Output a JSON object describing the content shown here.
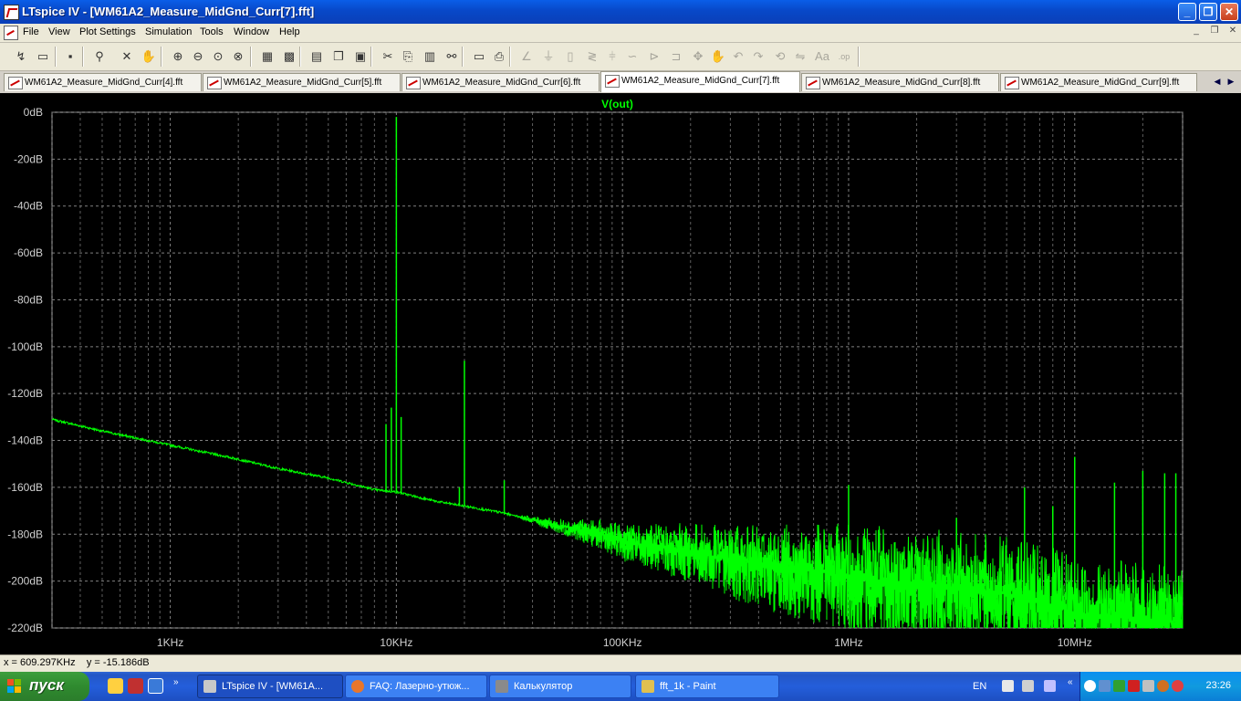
{
  "window": {
    "title": "LTspice IV - [WM61A2_Measure_MidGnd_Curr[7].fft]",
    "controls": {
      "minimize": "_",
      "restore": "❐",
      "close": "✕"
    }
  },
  "menubar": {
    "items": [
      "File",
      "View",
      "Plot Settings",
      "Simulation",
      "Tools",
      "Window",
      "Help"
    ],
    "mdi": {
      "minimize": "_",
      "restore": "❐",
      "close": "✕"
    }
  },
  "toolbar": {
    "buttons": [
      {
        "icon": "run-icon",
        "glyph": "↯"
      },
      {
        "icon": "open-icon",
        "glyph": "▭"
      },
      {
        "icon": "save-icon",
        "glyph": "▪"
      },
      {
        "icon": "probe-icon",
        "glyph": "⚲"
      },
      {
        "icon": "halt-icon",
        "glyph": "✕"
      },
      {
        "icon": "pan-icon",
        "glyph": "✋"
      },
      {
        "icon": "zoom-in-icon",
        "glyph": "⊕"
      },
      {
        "icon": "zoom-out-icon",
        "glyph": "⊖"
      },
      {
        "icon": "zoom-fit-icon",
        "glyph": "⊙"
      },
      {
        "icon": "zoom-cancel-icon",
        "glyph": "⊗"
      },
      {
        "icon": "autorange-icon",
        "glyph": "▦"
      },
      {
        "icon": "grid-icon",
        "glyph": "▩"
      },
      {
        "icon": "tile-horizontal-icon",
        "glyph": "▤"
      },
      {
        "icon": "cascade-icon",
        "glyph": "❐"
      },
      {
        "icon": "close-window-icon",
        "glyph": "▣"
      },
      {
        "icon": "cut-icon",
        "glyph": "✂"
      },
      {
        "icon": "copy-icon",
        "glyph": "⎘"
      },
      {
        "icon": "paste-icon",
        "glyph": "▥"
      },
      {
        "icon": "find-icon",
        "glyph": "⚯"
      },
      {
        "icon": "print-setup-icon",
        "glyph": "▭"
      },
      {
        "icon": "print-icon",
        "glyph": "⎙"
      },
      {
        "icon": "wire-icon",
        "glyph": "∠"
      },
      {
        "icon": "ground-icon",
        "glyph": "⏚"
      },
      {
        "icon": "label-icon",
        "glyph": "▯"
      },
      {
        "icon": "resistor-icon",
        "glyph": "≷"
      },
      {
        "icon": "capacitor-icon",
        "glyph": "⫩"
      },
      {
        "icon": "inductor-icon",
        "glyph": "∽"
      },
      {
        "icon": "diode-icon",
        "glyph": "⊳"
      },
      {
        "icon": "component-icon",
        "glyph": "⊐"
      },
      {
        "icon": "move-icon",
        "glyph": "✥"
      },
      {
        "icon": "drag-icon",
        "glyph": "✋"
      },
      {
        "icon": "undo-icon",
        "glyph": "↶"
      },
      {
        "icon": "redo-icon",
        "glyph": "↷"
      },
      {
        "icon": "rotate-icon",
        "glyph": "⟲"
      },
      {
        "icon": "mirror-icon",
        "glyph": "⇋"
      },
      {
        "icon": "text-icon",
        "glyph": "Aa"
      },
      {
        "icon": "spice-directive-icon",
        "glyph": ".op"
      }
    ]
  },
  "tabs": [
    {
      "label": "WM61A2_Measure_MidGnd_Curr[4].fft",
      "active": false
    },
    {
      "label": "WM61A2_Measure_MidGnd_Curr[5].fft",
      "active": false
    },
    {
      "label": "WM61A2_Measure_MidGnd_Curr[6].fft",
      "active": false
    },
    {
      "label": "WM61A2_Measure_MidGnd_Curr[7].fft",
      "active": true
    },
    {
      "label": "WM61A2_Measure_MidGnd_Curr[8].fft",
      "active": false
    },
    {
      "label": "WM61A2_Measure_MidGnd_Curr[9].fft",
      "active": false
    }
  ],
  "tab_nav": {
    "prev": "◀",
    "next": "▶"
  },
  "chart_data": {
    "type": "line",
    "trace_label": "V(out)",
    "x_scale": "log",
    "xlim": [
      300,
      30000000
    ],
    "ylim": [
      -220,
      0
    ],
    "x_ticks": [
      {
        "value": 1000,
        "label": "1KHz"
      },
      {
        "value": 10000,
        "label": "10KHz"
      },
      {
        "value": 100000,
        "label": "100KHz"
      },
      {
        "value": 1000000,
        "label": "1MHz"
      },
      {
        "value": 10000000,
        "label": "10MHz"
      }
    ],
    "y_ticks": [
      {
        "value": 0,
        "label": "0dB"
      },
      {
        "value": -20,
        "label": "-20dB"
      },
      {
        "value": -40,
        "label": "-40dB"
      },
      {
        "value": -60,
        "label": "-60dB"
      },
      {
        "value": -80,
        "label": "-80dB"
      },
      {
        "value": -100,
        "label": "-100dB"
      },
      {
        "value": -120,
        "label": "-120dB"
      },
      {
        "value": -140,
        "label": "-140dB"
      },
      {
        "value": -160,
        "label": "-160dB"
      },
      {
        "value": -180,
        "label": "-180dB"
      },
      {
        "value": -200,
        "label": "-200dB"
      },
      {
        "value": -220,
        "label": "-220dB"
      }
    ],
    "grid": true,
    "series": [
      {
        "color": "#00ff00",
        "x": [
          300,
          500,
          1000,
          2000,
          3000,
          5000,
          8000,
          10000,
          15000,
          20000,
          30000,
          50000,
          80000,
          100000,
          200000,
          300000,
          500000,
          1000000,
          2000000,
          5000000,
          8000000,
          10000000,
          20000000,
          30000000
        ],
        "y": [
          -131,
          -136,
          -142,
          -148,
          -152,
          -156,
          -161,
          -162,
          -166,
          -168,
          -171,
          -176,
          -180,
          -183,
          -187,
          -191,
          -194,
          -198,
          -201,
          -205,
          -210,
          -214,
          -216,
          -218
        ],
        "spikes": [
          {
            "x": 9000,
            "y": -133
          },
          {
            "x": 9500,
            "y": -126
          },
          {
            "x": 10000,
            "y": -2
          },
          {
            "x": 10500,
            "y": -130
          },
          {
            "x": 20000,
            "y": -106
          },
          {
            "x": 19000,
            "y": -160
          },
          {
            "x": 30000,
            "y": -157
          },
          {
            "x": 1000000,
            "y": -159
          },
          {
            "x": 3000000,
            "y": -173
          },
          {
            "x": 6000000,
            "y": -160
          },
          {
            "x": 8000000,
            "y": -168
          },
          {
            "x": 10000000,
            "y": -147
          },
          {
            "x": 15000000,
            "y": -158
          },
          {
            "x": 20000000,
            "y": -153
          },
          {
            "x": 25000000,
            "y": -154
          },
          {
            "x": 28000000,
            "y": -154
          }
        ]
      }
    ]
  },
  "status": {
    "x_readout": "x = 609.297KHz",
    "y_readout": "y = -15.186dB"
  },
  "taskbar": {
    "start_label": "пуск",
    "tasks": [
      {
        "label": "LTspice IV - [WM61A...",
        "active": true,
        "color": "#c8c8c8"
      },
      {
        "label": "FAQ: Лазерно-утюж...",
        "active": false,
        "color": "#e8762c"
      },
      {
        "label": "Калькулятор",
        "active": false,
        "color": "#8a8a8a"
      },
      {
        "label": "fft_1k - Paint",
        "active": false,
        "color": "#e0c050"
      }
    ],
    "lang": "EN",
    "clock": "23:26"
  }
}
